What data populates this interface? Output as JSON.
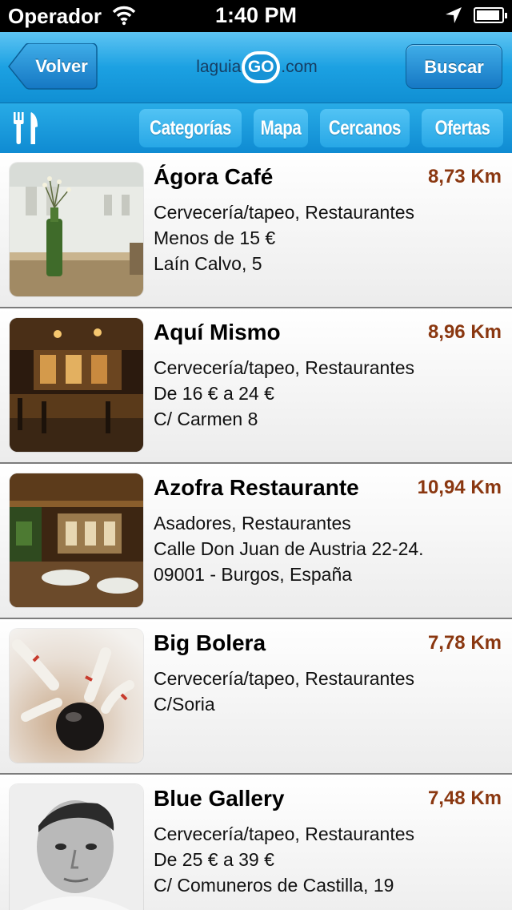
{
  "status_bar": {
    "carrier": "Operador",
    "time": "1:40 PM"
  },
  "nav": {
    "back_label": "Volver",
    "logo_left": "laguia",
    "logo_go": "GO",
    "logo_right": ".com",
    "search_label": "Buscar"
  },
  "tabs": [
    "Categorías",
    "Mapa",
    "Cercanos",
    "Ofertas"
  ],
  "listings": [
    {
      "name": "Ágora Café",
      "distance": "8,73 Km",
      "lines": [
        "Cervecería/tapeo, Restaurantes",
        "Menos de 15 €",
        "Laín Calvo, 5"
      ]
    },
    {
      "name": "Aquí Mismo",
      "distance": "8,96 Km",
      "lines": [
        "Cervecería/tapeo, Restaurantes",
        "De 16 € a 24 €",
        "C/ Carmen 8"
      ]
    },
    {
      "name": "Azofra Restaurante",
      "distance": "10,94 Km",
      "lines": [
        "Asadores, Restaurantes",
        "Calle Don Juan de Austria 22-24.",
        "09001 - Burgos, España"
      ]
    },
    {
      "name": "Big Bolera",
      "distance": "7,78 Km",
      "lines": [
        "Cervecería/tapeo, Restaurantes",
        "C/Soria"
      ]
    },
    {
      "name": "Blue Gallery",
      "distance": "7,48 Km",
      "lines": [
        "Cervecería/tapeo, Restaurantes",
        "De 25 € a 39 €",
        "C/ Comuneros de Castilla, 19"
      ]
    }
  ],
  "colors": {
    "nav_blue": "#1ca1e2",
    "distance_brown": "#8a3710"
  },
  "icons": {
    "cutlery": "fork-knife-icon",
    "back": "back-arrow-button",
    "wifi": "wifi-icon",
    "location": "location-arrow-icon",
    "battery": "battery-icon"
  }
}
